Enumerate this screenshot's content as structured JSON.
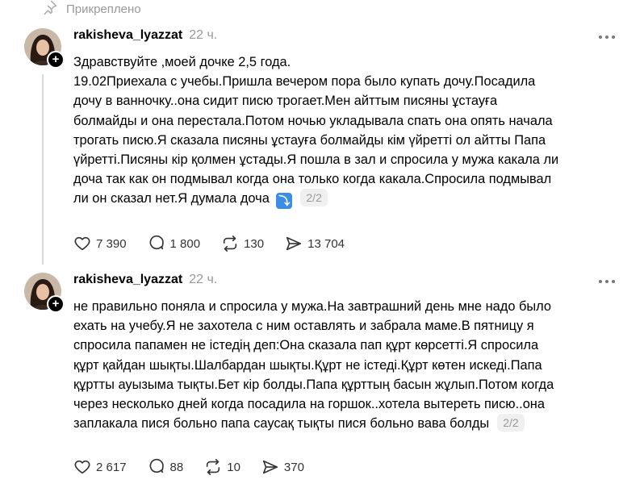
{
  "pinned": {
    "label": "Прикреплено"
  },
  "posts": [
    {
      "username": "rakisheva_lyazzat",
      "time": "22 ч.",
      "lines": [
        "Здравствуйте ,моей дочке 2,5 года.",
        "19.02Приехала с учебы.Пришла вечером пора было купать дочу.Посадила",
        "дочу в ванночку..она сидит писю трогает.Мен айттым писяны ұстауға",
        "болмайды и она перестала.Потом ночью укладывала спать она опять начала",
        "трогать писю.Я сказала писяны ұстауға болмайды кім үйретті ол айтты Папа",
        "үйретті.Писяны кір қолмен ұстады.Я пошла в зал и спросила у мужа какала ли",
        "доча так как он подмывал когда она только когда какала.Спросила подмывал",
        "ли он сказал нет.Я думала доча"
      ],
      "emoji": "⤵",
      "pager": "2/2",
      "likes": "7 390",
      "comments": "1 800",
      "reposts": "130",
      "shares": "13 704"
    },
    {
      "username": "rakisheva_lyazzat",
      "time": "22 ч.",
      "lines": [
        "не правильно поняла и спросила у мужа.На завтрашний день мне надо было",
        "ехать на учебу.Я не захотела с ним оставлять и забрала маме.В пятницу я",
        "спросила папамен не істедің деп:Она сказала пап құрт көрсетті.Я спросила",
        "құрт қайдан шықты.Шалбардан шықты.Құрт не істеді.Құрт көтен искеді.Папа",
        "құртты ауызыма тықты.Бет кір болды.Папа құрттың басын жұлып.Потом когда",
        "через несколько дней когда посадила на горшок..хотела вытереть писю..она",
        "заплакала пися больно папа саусақ тықты пися больно вава болды"
      ],
      "pager": "2/2",
      "likes": "2 617",
      "comments": "88",
      "reposts": "10",
      "shares": "370"
    }
  ],
  "icons": {
    "pin": "pin-icon",
    "like": "heart-icon",
    "comment": "comment-icon",
    "repost": "repost-icon",
    "share": "share-icon",
    "more": "more-icon"
  },
  "colors": {
    "muted": "#999999",
    "emoji_bg": "#3a8ee6",
    "pager_bg": "#f0f0f0"
  }
}
